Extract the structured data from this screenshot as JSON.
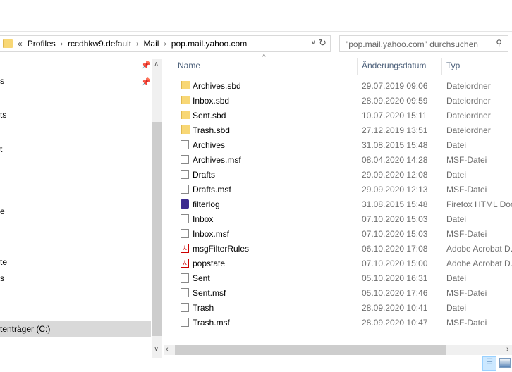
{
  "address": {
    "crumbs": [
      "Profiles",
      "rccdhkw9.default",
      "Mail",
      "pop.mail.yahoo.com"
    ],
    "overflow": "«"
  },
  "search": {
    "placeholder": "\"pop.mail.yahoo.com\" durchsuchen"
  },
  "nav": {
    "items": [
      "s",
      "ts",
      "t",
      "e",
      "te",
      "s",
      "tenträger (C:)"
    ]
  },
  "columns": {
    "name": "Name",
    "date": "Änderungsdatum",
    "type": "Typ"
  },
  "files": [
    {
      "name": "Archives.sbd",
      "date": "29.07.2019 09:06",
      "type": "Dateiordner",
      "icon": "folder"
    },
    {
      "name": "Inbox.sbd",
      "date": "28.09.2020 09:59",
      "type": "Dateiordner",
      "icon": "folder"
    },
    {
      "name": "Sent.sbd",
      "date": "10.07.2020 15:11",
      "type": "Dateiordner",
      "icon": "folder"
    },
    {
      "name": "Trash.sbd",
      "date": "27.12.2019 13:51",
      "type": "Dateiordner",
      "icon": "folder"
    },
    {
      "name": "Archives",
      "date": "31.08.2015 15:48",
      "type": "Datei",
      "icon": "file"
    },
    {
      "name": "Archives.msf",
      "date": "08.04.2020 14:28",
      "type": "MSF-Datei",
      "icon": "file"
    },
    {
      "name": "Drafts",
      "date": "29.09.2020 12:08",
      "type": "Datei",
      "icon": "file"
    },
    {
      "name": "Drafts.msf",
      "date": "29.09.2020 12:13",
      "type": "MSF-Datei",
      "icon": "file"
    },
    {
      "name": "filterlog",
      "date": "31.08.2015 15:48",
      "type": "Firefox HTML Doc",
      "icon": "firefox"
    },
    {
      "name": "Inbox",
      "date": "07.10.2020 15:03",
      "type": "Datei",
      "icon": "file"
    },
    {
      "name": "Inbox.msf",
      "date": "07.10.2020 15:03",
      "type": "MSF-Datei",
      "icon": "file"
    },
    {
      "name": "msgFilterRules",
      "date": "06.10.2020 17:08",
      "type": "Adobe Acrobat D.",
      "icon": "pdf"
    },
    {
      "name": "popstate",
      "date": "07.10.2020 15:00",
      "type": "Adobe Acrobat D.",
      "icon": "pdf"
    },
    {
      "name": "Sent",
      "date": "05.10.2020 16:31",
      "type": "Datei",
      "icon": "file"
    },
    {
      "name": "Sent.msf",
      "date": "05.10.2020 17:46",
      "type": "MSF-Datei",
      "icon": "file"
    },
    {
      "name": "Trash",
      "date": "28.09.2020 10:41",
      "type": "Datei",
      "icon": "file"
    },
    {
      "name": "Trash.msf",
      "date": "28.09.2020 10:47",
      "type": "MSF-Datei",
      "icon": "file"
    }
  ]
}
